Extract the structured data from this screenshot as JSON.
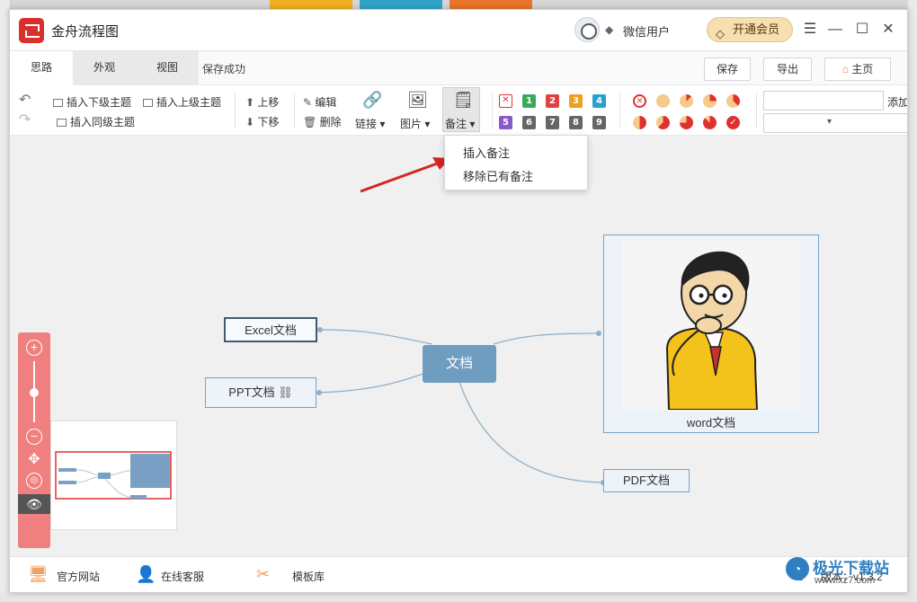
{
  "window": {
    "title": "金舟流程图"
  },
  "user": {
    "name": "微信用户",
    "vip_label": "开通会员"
  },
  "tabs": [
    {
      "label": "思路"
    },
    {
      "label": "外观"
    },
    {
      "label": "视图"
    }
  ],
  "status": {
    "saved": "保存成功"
  },
  "topbuttons": {
    "save": "保存",
    "export": "导出",
    "home": "主页"
  },
  "toolbar": {
    "insert_child": "插入下级主题",
    "insert_parent": "插入上级主题",
    "insert_sibling": "插入同级主题",
    "move_up": "上移",
    "move_down": "下移",
    "edit": "编辑",
    "delete": "删除",
    "link": "链接",
    "image": "图片",
    "note": "备注",
    "add": "添加",
    "priority_marks": [
      "1",
      "2",
      "3",
      "4",
      "5",
      "6",
      "7",
      "8",
      "9"
    ]
  },
  "dropdown": {
    "items": [
      "插入备注",
      "移除已有备注"
    ]
  },
  "mindmap": {
    "root": "文档",
    "nodes": [
      "Excel文档",
      "PPT文档",
      "word文档",
      "PDF文档"
    ]
  },
  "footer": {
    "site": "官方网站",
    "service": "在线客服",
    "templates": "模板库",
    "version": "版本：v1.3.2"
  },
  "watermark": {
    "text": "极光下载站",
    "url": "www.xz7.com"
  },
  "colors": {
    "accent": "#d9302c",
    "node_fill": "#6f9dc0",
    "zoom_panel": "#f08080",
    "arrow": "#d42424"
  }
}
